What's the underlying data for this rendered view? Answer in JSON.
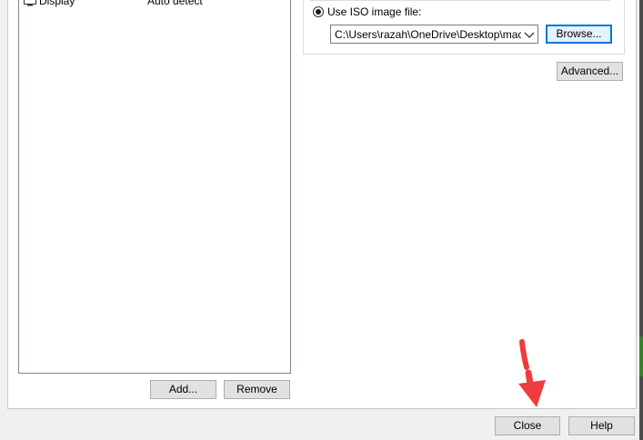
{
  "devices": [
    {
      "name": "Display",
      "summary": "Auto detect",
      "icon": "monitor-icon"
    }
  ],
  "list_buttons": {
    "add": "Add...",
    "remove": "Remove"
  },
  "cd": {
    "iso_label": "Use ISO image file:",
    "iso_path": "C:\\Users\\razah\\OneDrive\\Desktop\\macOS",
    "browse": "Browse...",
    "advanced": "Advanced..."
  },
  "footer": {
    "close": "Close",
    "help": "Help"
  },
  "colors": {
    "annotation_arrow": "#ef3b3b",
    "focus_border": "#0078d7"
  }
}
